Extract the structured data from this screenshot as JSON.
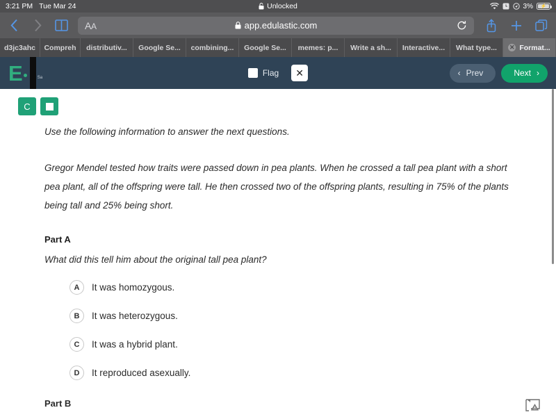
{
  "status_bar": {
    "time": "3:21 PM",
    "date": "Tue Mar 24",
    "lock_status": "Unlocked",
    "battery_percent": "3%",
    "icons": [
      "lock-icon",
      "wifi-icon",
      "alarm-icon",
      "location-icon",
      "battery-charging-icon"
    ]
  },
  "browser": {
    "back_icon": "chevron-left-icon",
    "forward_icon": "chevron-right-icon",
    "bookmarks_icon": "book-icon",
    "reader_label": "ᴀA",
    "url": "app.edulastic.com",
    "url_lock_icon": "padlock-icon",
    "reload_icon": "reload-icon",
    "share_icon": "share-icon",
    "new_tab_icon": "plus-icon",
    "tabs_overview_icon": "tabs-icon",
    "tabs": [
      {
        "label": "d3jc3ahc",
        "active": false,
        "has_close": false
      },
      {
        "label": "Compreh",
        "active": false,
        "has_close": false
      },
      {
        "label": "distributiv...",
        "active": false,
        "has_close": false
      },
      {
        "label": "Google Se...",
        "active": false,
        "has_close": false
      },
      {
        "label": "combining...",
        "active": false,
        "has_close": false
      },
      {
        "label": "Google Se...",
        "active": false,
        "has_close": false
      },
      {
        "label": "memes: p...",
        "active": false,
        "has_close": false
      },
      {
        "label": "Write a sh...",
        "active": false,
        "has_close": false
      },
      {
        "label": "Interactive...",
        "active": false,
        "has_close": false
      },
      {
        "label": "What type...",
        "active": false,
        "has_close": false
      },
      {
        "label": "Format...",
        "active": true,
        "has_close": true
      }
    ]
  },
  "app_header": {
    "logo_letter": "E",
    "logo_icon": "edulastic-logo-icon",
    "save_stub_text": "Sa",
    "flag_label": "Flag",
    "flag_checked": false,
    "close_label": "✕",
    "prev_label": "Prev",
    "next_label": "Next",
    "prev_chevron": "‹",
    "next_chevron": "›"
  },
  "tools": [
    {
      "name": "calculator-tool",
      "label": "C"
    },
    {
      "name": "mask-tool",
      "label": ""
    }
  ],
  "question": {
    "lead_in": "Use the following information to answer the next questions.",
    "passage": "Gregor Mendel tested how traits were passed down in pea plants. When he crossed a tall pea plant with a short pea plant, all of the offspring were tall. He then crossed two of the offspring plants, resulting in 75% of the plants being tall and 25% being short.",
    "part_a_title": "Part A",
    "part_a_question": "What did this tell him about the original tall pea plant?",
    "choices": [
      {
        "letter": "A",
        "text": "It was homozygous."
      },
      {
        "letter": "B",
        "text": "It was heterozygous."
      },
      {
        "letter": "C",
        "text": "It was a hybrid plant."
      },
      {
        "letter": "D",
        "text": "It reproduced asexually."
      }
    ],
    "part_b_title": "Part B"
  },
  "footer": {
    "broken_image_icon": "broken-image-icon"
  },
  "colors": {
    "brand_green": "#20a177",
    "next_green": "#11a36b",
    "header_navy": "#2f4356",
    "status_gray": "#4e4e50",
    "toolbar_gray": "#5a5a5c"
  }
}
